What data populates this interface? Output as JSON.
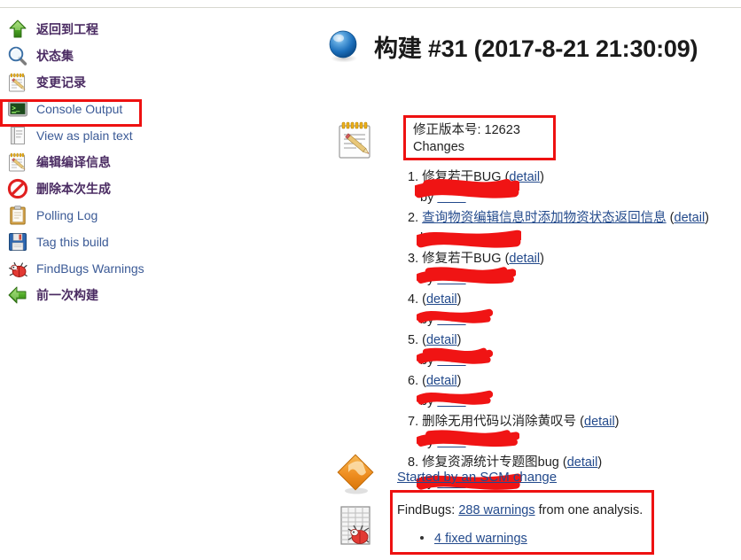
{
  "window": {
    "accent_red": "#ee1111",
    "link_blue": "#234a8c",
    "sidebar_zh_color": "#4a2b62",
    "sidebar_en_color": "#3b5a96"
  },
  "sidebar": {
    "items": [
      {
        "label": "返回到工程",
        "icon": "up-arrow-green-icon",
        "lang": "zh"
      },
      {
        "label": "状态集",
        "icon": "magnifier-icon",
        "lang": "zh"
      },
      {
        "label": "变更记录",
        "icon": "notepad-pencil-icon",
        "lang": "zh"
      },
      {
        "label": "Console Output",
        "icon": "terminal-icon",
        "lang": "en",
        "highlighted": true
      },
      {
        "label": "View as plain text",
        "icon": "plain-document-icon",
        "lang": "en"
      },
      {
        "label": "编辑编译信息",
        "icon": "notepad-pencil-icon",
        "lang": "zh"
      },
      {
        "label": "删除本次生成",
        "icon": "no-entry-icon",
        "lang": "zh"
      },
      {
        "label": "Polling Log",
        "icon": "clipboard-icon",
        "lang": "en"
      },
      {
        "label": "Tag this build",
        "icon": "floppy-disk-icon",
        "lang": "en"
      },
      {
        "label": "FindBugs Warnings",
        "icon": "red-bug-icon",
        "lang": "en"
      },
      {
        "label": "前一次构建",
        "icon": "left-arrow-green-icon",
        "lang": "zh"
      }
    ]
  },
  "header": {
    "title": "构建 #31 (2017-8-21 21:30:09)",
    "status_icon": "blue-ball-icon"
  },
  "revision": {
    "icon": "notepad-pencil-icon",
    "label": "修正版本号: 12623",
    "changes_label": "Changes",
    "highlighted": true
  },
  "changes": {
    "detail_label": "detail",
    "by_prefix": "by",
    "items": [
      {
        "num": "1.",
        "message": "修复若干BUG",
        "author_redacted": true
      },
      {
        "num": "2.",
        "message": "查询物资编辑信息时添加物资状态返回信息",
        "author_redacted": true,
        "message_is_link": true
      },
      {
        "num": "3.",
        "message": "修复若干BUG",
        "author_redacted": true
      },
      {
        "num": "4.",
        "message": "",
        "author_redacted": true
      },
      {
        "num": "5.",
        "message": "",
        "author_redacted": true
      },
      {
        "num": "6.",
        "message": "",
        "author_redacted": true
      },
      {
        "num": "7.",
        "message": "删除无用代码以消除黄叹号",
        "author_redacted": true
      },
      {
        "num": "8.",
        "message": "修复资源统计专题图bug",
        "author_redacted": true
      }
    ]
  },
  "cause": {
    "icon": "orange-diamond-icon",
    "scm_link": "Started by an SCM change"
  },
  "findbugs": {
    "icon": "findbugs-grid-bug-icon",
    "prefix": "FindBugs:",
    "warnings_link": "288 warnings",
    "suffix": "from one analysis.",
    "fixed_link": "4 fixed warnings",
    "highlighted": true
  }
}
